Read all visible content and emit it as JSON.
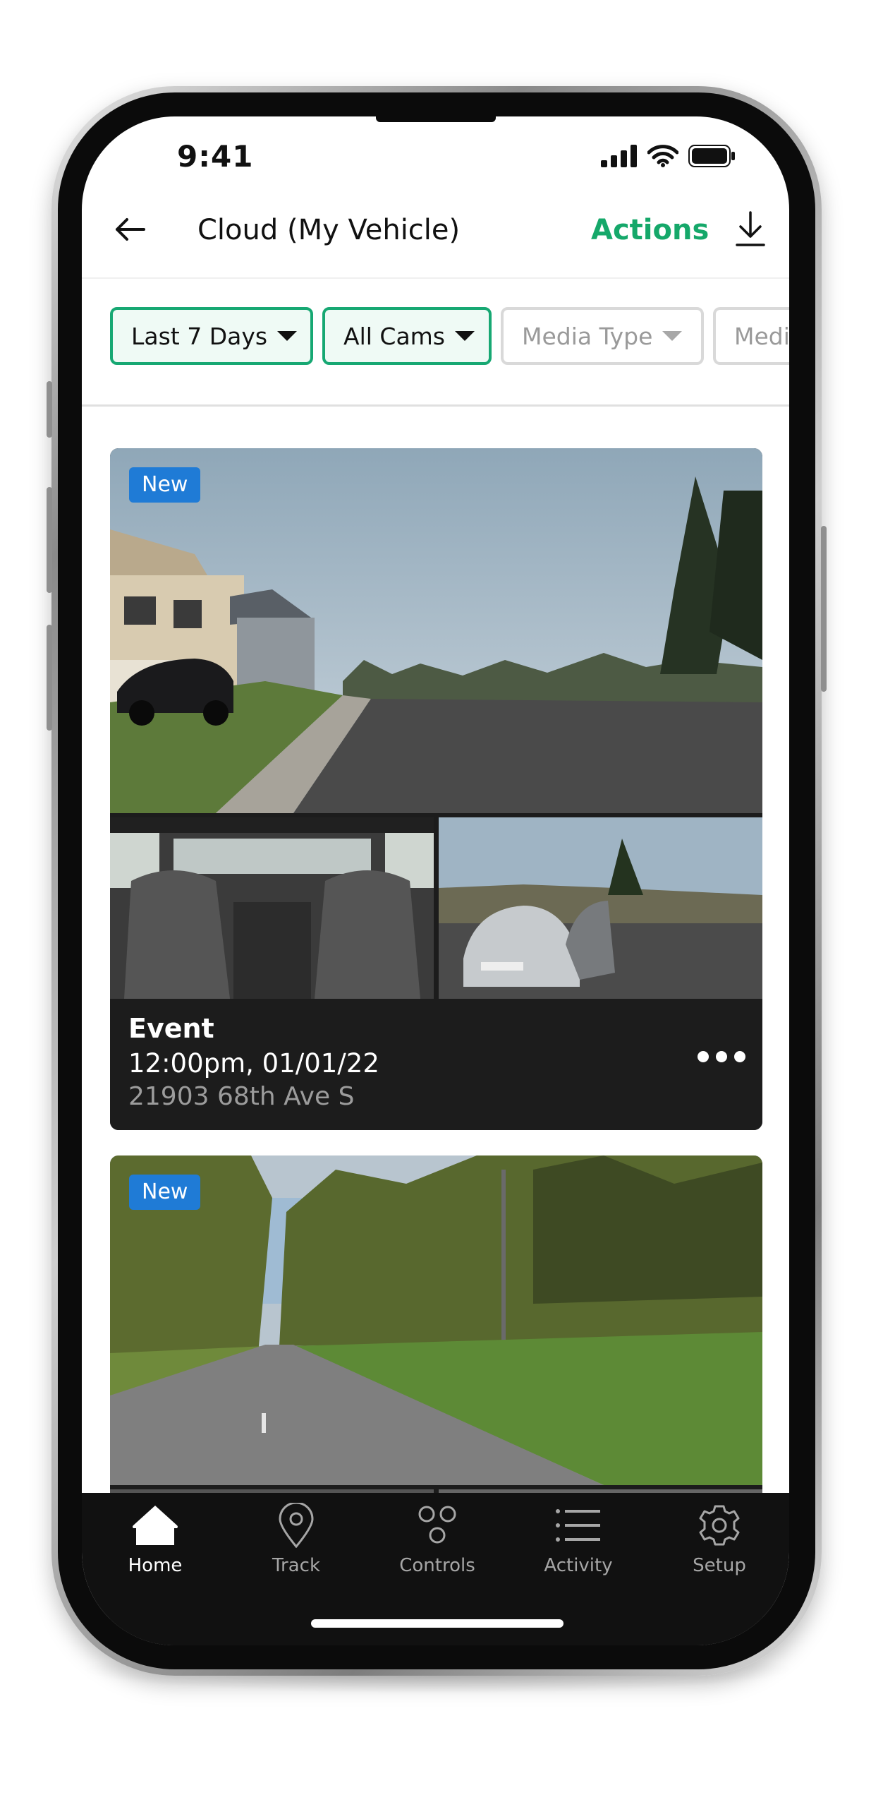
{
  "status_bar": {
    "time": "9:41"
  },
  "header": {
    "title": "Cloud (My Vehicle)",
    "actions_label": "Actions",
    "accent_color": "#15a86a"
  },
  "filters": [
    {
      "label": "Last 7 Days",
      "active": true
    },
    {
      "label": "All Cams",
      "active": true
    },
    {
      "label": "Media Type",
      "active": false
    },
    {
      "label": "Media",
      "active": false
    }
  ],
  "events": [
    {
      "badge": "New",
      "title": "Event",
      "time": "12:00pm, 01/01/22",
      "address": "21903 68th Ave S"
    },
    {
      "badge": "New"
    }
  ],
  "tabbar": {
    "items": [
      {
        "label": "Home",
        "icon": "home-icon",
        "active": true
      },
      {
        "label": "Track",
        "icon": "location-pin-icon",
        "active": false
      },
      {
        "label": "Controls",
        "icon": "controls-icon",
        "active": false
      },
      {
        "label": "Activity",
        "icon": "list-icon",
        "active": false
      },
      {
        "label": "Setup",
        "icon": "gear-icon",
        "active": false
      }
    ]
  }
}
